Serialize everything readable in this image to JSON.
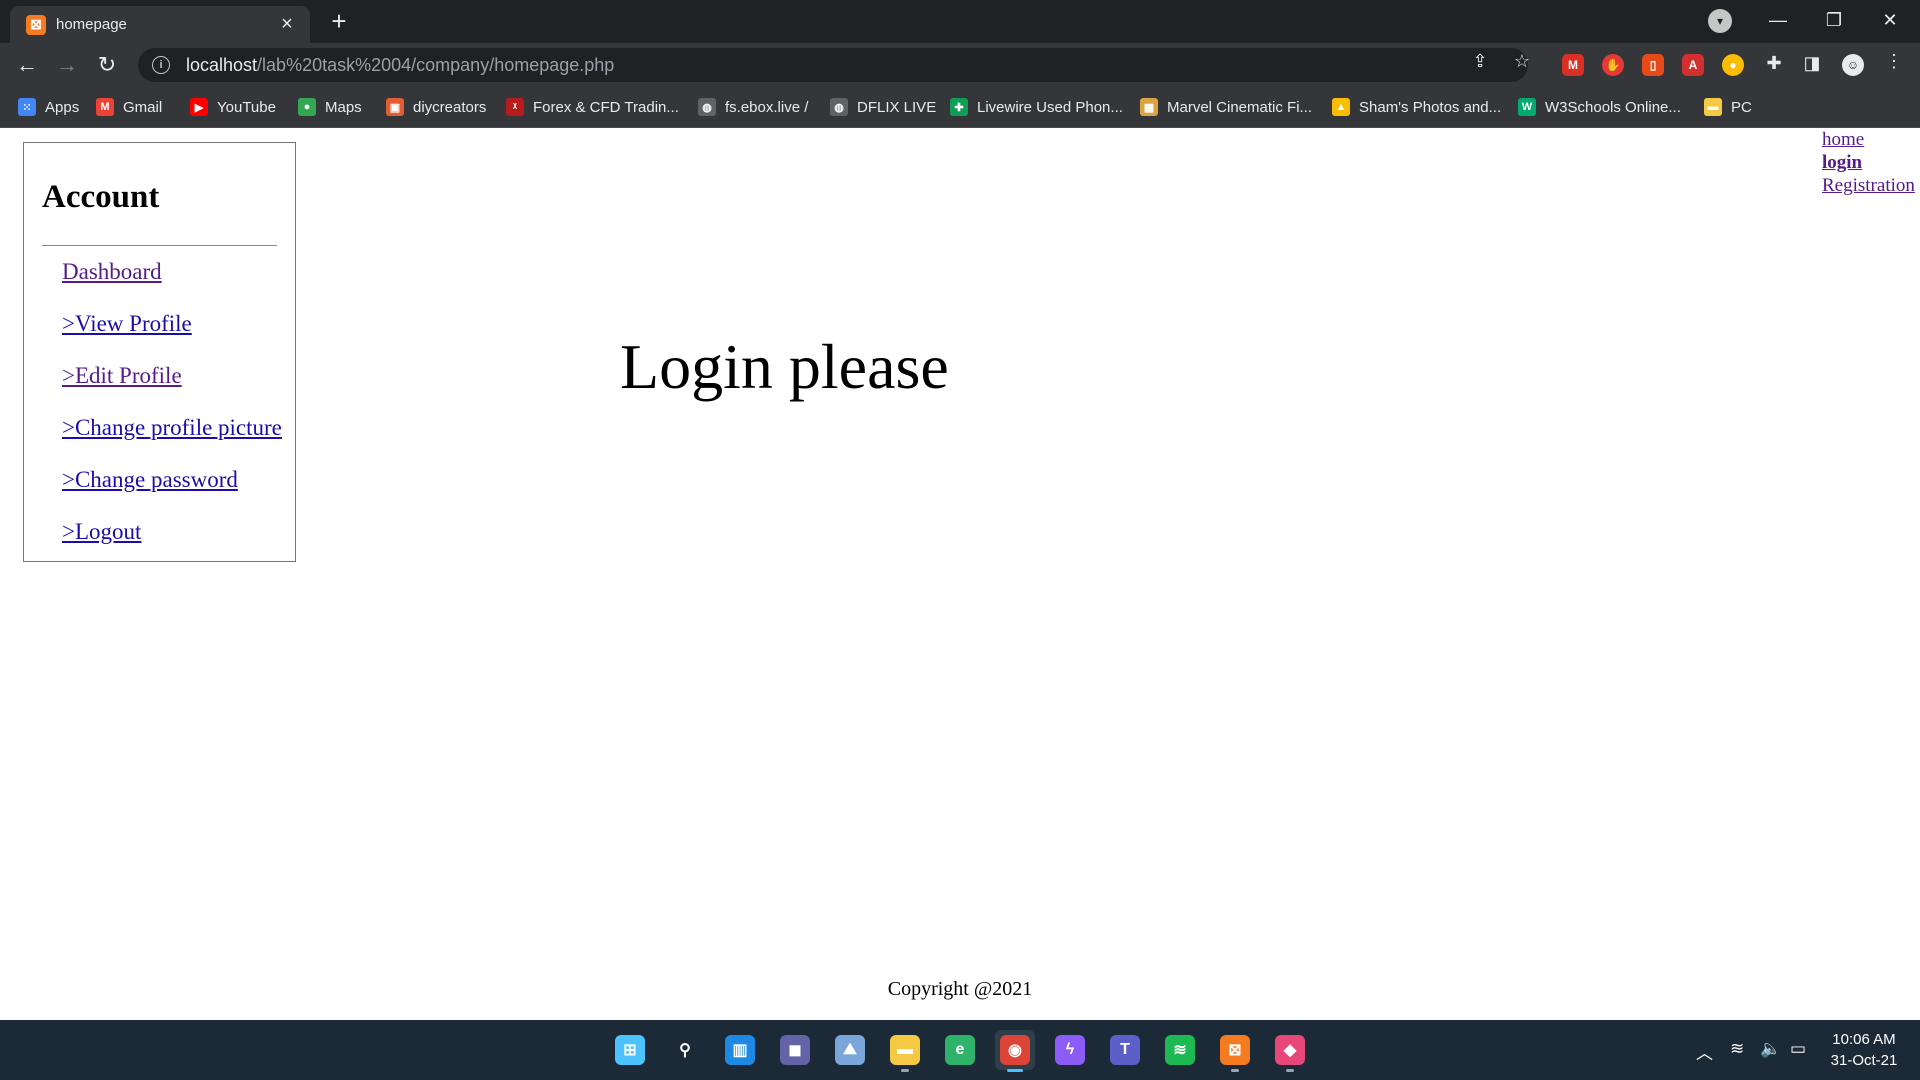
{
  "browser": {
    "tab_title": "homepage",
    "url_host": "localhost",
    "url_path": "/lab%20task%2004/company/homepage.php",
    "bookmarks": [
      {
        "label": "Apps",
        "icon": "apps-grid-icon",
        "color": "#4285f4"
      },
      {
        "label": "Gmail",
        "icon": "gmail-icon",
        "color": "#ea4335"
      },
      {
        "label": "YouTube",
        "icon": "youtube-icon",
        "color": "#ff0000"
      },
      {
        "label": "Maps",
        "icon": "maps-pin-icon",
        "color": "#34a853"
      },
      {
        "label": "diycreators",
        "icon": "diycreators-icon",
        "color": "#e25d33"
      },
      {
        "label": "Forex & CFD Tradin...",
        "icon": "forex-icon",
        "color": "#b71c1c"
      },
      {
        "label": "fs.ebox.live /",
        "icon": "globe-icon",
        "color": "#5f6368"
      },
      {
        "label": "DFLIX LIVE",
        "icon": "globe-icon",
        "color": "#5f6368"
      },
      {
        "label": "Livewire Used Phon...",
        "icon": "livewire-icon",
        "color": "#0f9d58"
      },
      {
        "label": "Marvel Cinematic Fi...",
        "icon": "marvel-icon",
        "color": "#d9a441"
      },
      {
        "label": "Sham's Photos and...",
        "icon": "google-drive-icon",
        "color": "#fbbc04"
      },
      {
        "label": "W3Schools Online...",
        "icon": "w3schools-icon",
        "color": "#04aa6d"
      },
      {
        "label": "PC",
        "icon": "folder-icon",
        "color": "#f6c945"
      }
    ]
  },
  "page": {
    "sidebar": {
      "title": "Account",
      "links": [
        {
          "label": "Dashboard",
          "visited": true
        },
        {
          "label": ">View Profile",
          "visited": false
        },
        {
          "label": ">Edit Profile",
          "visited": true
        },
        {
          "label": ">Change profile picture",
          "visited": false
        },
        {
          "label": ">Change password",
          "visited": false
        },
        {
          "label": ">Logout",
          "visited": false
        }
      ]
    },
    "top_links": [
      {
        "label": "home",
        "bold": false
      },
      {
        "label": "login",
        "bold": true
      },
      {
        "label": "Registration",
        "bold": false
      }
    ],
    "heading": "Login please",
    "footer": "Copyright @2021"
  },
  "taskbar": {
    "apps": [
      {
        "name": "start",
        "icon": "windows-start-icon",
        "color": "#4cc2ff"
      },
      {
        "name": "search",
        "icon": "search-icon",
        "color": "#ffffff"
      },
      {
        "name": "widgets",
        "icon": "widgets-icon",
        "color": "#1e88e5"
      },
      {
        "name": "chat",
        "icon": "teams-chat-icon",
        "color": "#6264a7"
      },
      {
        "name": "photos",
        "icon": "photos-icon",
        "color": "#7aa6d9"
      },
      {
        "name": "file-explorer",
        "icon": "folder-icon",
        "color": "#f6c945"
      },
      {
        "name": "edge",
        "icon": "edge-icon",
        "color": "#2fb36b"
      },
      {
        "name": "chrome",
        "icon": "chrome-icon",
        "color": "#db4437"
      },
      {
        "name": "messenger",
        "icon": "messenger-icon",
        "color": "#8b5cf6"
      },
      {
        "name": "teams",
        "icon": "teams-icon",
        "color": "#5b5fc7"
      },
      {
        "name": "spotify",
        "icon": "spotify-icon",
        "color": "#1db954"
      },
      {
        "name": "xampp",
        "icon": "xampp-icon",
        "color": "#f47b20"
      },
      {
        "name": "paint",
        "icon": "paint-drop-icon",
        "color": "#e8477a"
      }
    ],
    "time": "10:06 AM",
    "date": "31-Oct-21"
  }
}
